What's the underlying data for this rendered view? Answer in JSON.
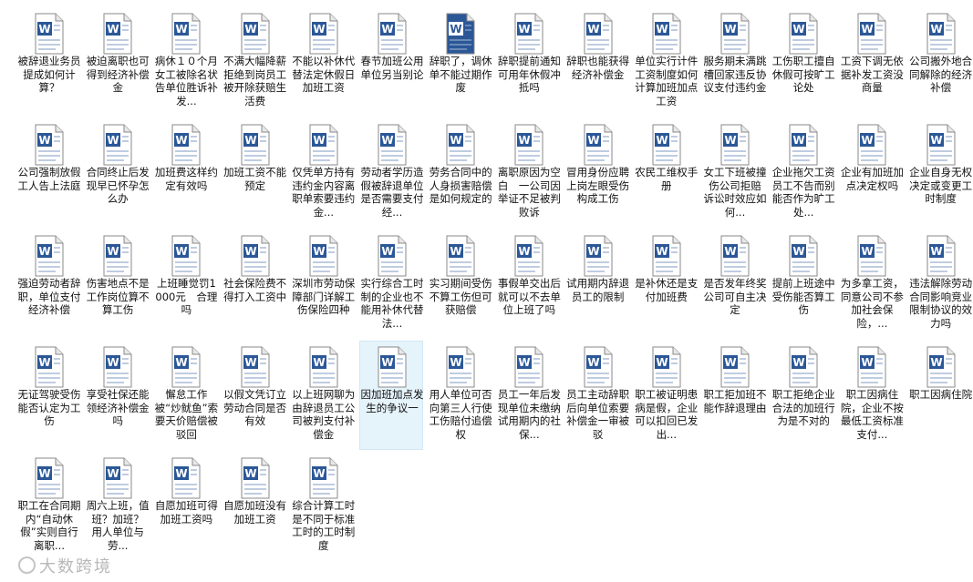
{
  "watermark": "大数跨境",
  "icon": {
    "name": "word-document-icon",
    "color": "#2b5797",
    "letter": "W"
  },
  "files": [
    {
      "label": "被辞退业务员提成如何计算？"
    },
    {
      "label": "被迫离职也可得到经济补偿金"
    },
    {
      "label": "病休１０个月女工被除名状告单位胜诉补发..."
    },
    {
      "label": "不满大幅降薪拒绝到岗员工被开除获赔生活费"
    },
    {
      "label": "不能以补休代替法定休假日加班工资"
    },
    {
      "label": "春节加班公用单位另当别论"
    },
    {
      "label": "辞职了，调休单不能过期作废",
      "accent": true
    },
    {
      "label": "辞职提前通知可用年休假冲抵吗"
    },
    {
      "label": "辞职也能获得经济补偿金"
    },
    {
      "label": "单位实行计件工资制度如何计算加班加点工资"
    },
    {
      "label": "服务期未满跳槽回家违反协议支付违约金"
    },
    {
      "label": "工伤职工擅自休假可按旷工论处"
    },
    {
      "label": "工资下调无依据补发工资没商量"
    },
    {
      "label": "公司搬外地合同解除的经济补偿"
    },
    {
      "label": "公司强制放假工人告上法庭"
    },
    {
      "label": "合同终止后发现早已怀孕怎么办"
    },
    {
      "label": "加班费这样约定有效吗"
    },
    {
      "label": "加班工资不能预定"
    },
    {
      "label": "仅凭单方持有违约金内容离职单索要违约金..."
    },
    {
      "label": "劳动者学历造假被辞退单位是否需要支付经..."
    },
    {
      "label": "劳务合同中的人身损害赔偿是如何规定的"
    },
    {
      "label": "离职原因为空白　一公司因举证不足被判败诉"
    },
    {
      "label": "冒用身份应聘上岗左眼受伤构成工伤"
    },
    {
      "label": "农民工维权手册"
    },
    {
      "label": "女工下班被撞伤公司拒赔　诉讼时效应如何..."
    },
    {
      "label": "企业拖欠工资员工不告而别能否作为旷工处..."
    },
    {
      "label": "企业有加班加点决定权吗"
    },
    {
      "label": "企业自身无权决定或变更工时制度"
    },
    {
      "label": "强迫劳动者辞职，单位支付经济补偿"
    },
    {
      "label": "伤害地点不是工作岗位算不算工伤"
    },
    {
      "label": "上班睡觉罚1000元　合理吗"
    },
    {
      "label": "社会保险费不得打入工资中"
    },
    {
      "label": "深圳市劳动保障部门详解工伤保险四种"
    },
    {
      "label": "实行综合工时制的企业也不能用补休代替法..."
    },
    {
      "label": "实习期间受伤不算工伤但可获赔偿"
    },
    {
      "label": "事假单交出后就可以不去单位上班了吗"
    },
    {
      "label": "试用期内辞退员工的限制"
    },
    {
      "label": "是补休还是支付加班费"
    },
    {
      "label": "是否发年终奖公司可自主决定"
    },
    {
      "label": "提前上班途中受伤能否算工伤"
    },
    {
      "label": "为多拿工资，同意公司不参加社会保险，..."
    },
    {
      "label": "违法解除劳动合同影响竞业限制协议的效力吗"
    },
    {
      "label": "无证驾驶受伤能否认定为工伤"
    },
    {
      "label": "享受社保还能领经济补偿金吗"
    },
    {
      "label": "懈怠工作被“炒鱿鱼”索要天价赔偿被驳回"
    },
    {
      "label": "以假文凭订立劳动合同是否有效"
    },
    {
      "label": "以上班网聊为由辞退员工公司被判支付补偿金"
    },
    {
      "label": "因加班加点发生的争议一",
      "selected": true
    },
    {
      "label": "用人单位可否向第三人行使工伤赔付追偿权"
    },
    {
      "label": "员工一年后发现单位未缴纳试用期内的社保..."
    },
    {
      "label": "员工主动辞职后向单位索要补偿金一审被驳"
    },
    {
      "label": "职工被证明患病是假，企业可以扣回已发出..."
    },
    {
      "label": "职工拒加班不能作辞退理由"
    },
    {
      "label": "职工拒绝企业合法的加班行为是不对的"
    },
    {
      "label": "职工因病住院，企业不按最低工资标准支付..."
    },
    {
      "label": "职工因病住院"
    },
    {
      "label": "职工在合同期内“自动休假”实则自行离职..."
    },
    {
      "label": "周六上班，值班？加班？　用人单位与劳..."
    },
    {
      "label": "自愿加班可得加班工资吗"
    },
    {
      "label": "自愿加班没有加班工资"
    },
    {
      "label": "综合计算工时是不同于标准工时的工时制度"
    }
  ]
}
